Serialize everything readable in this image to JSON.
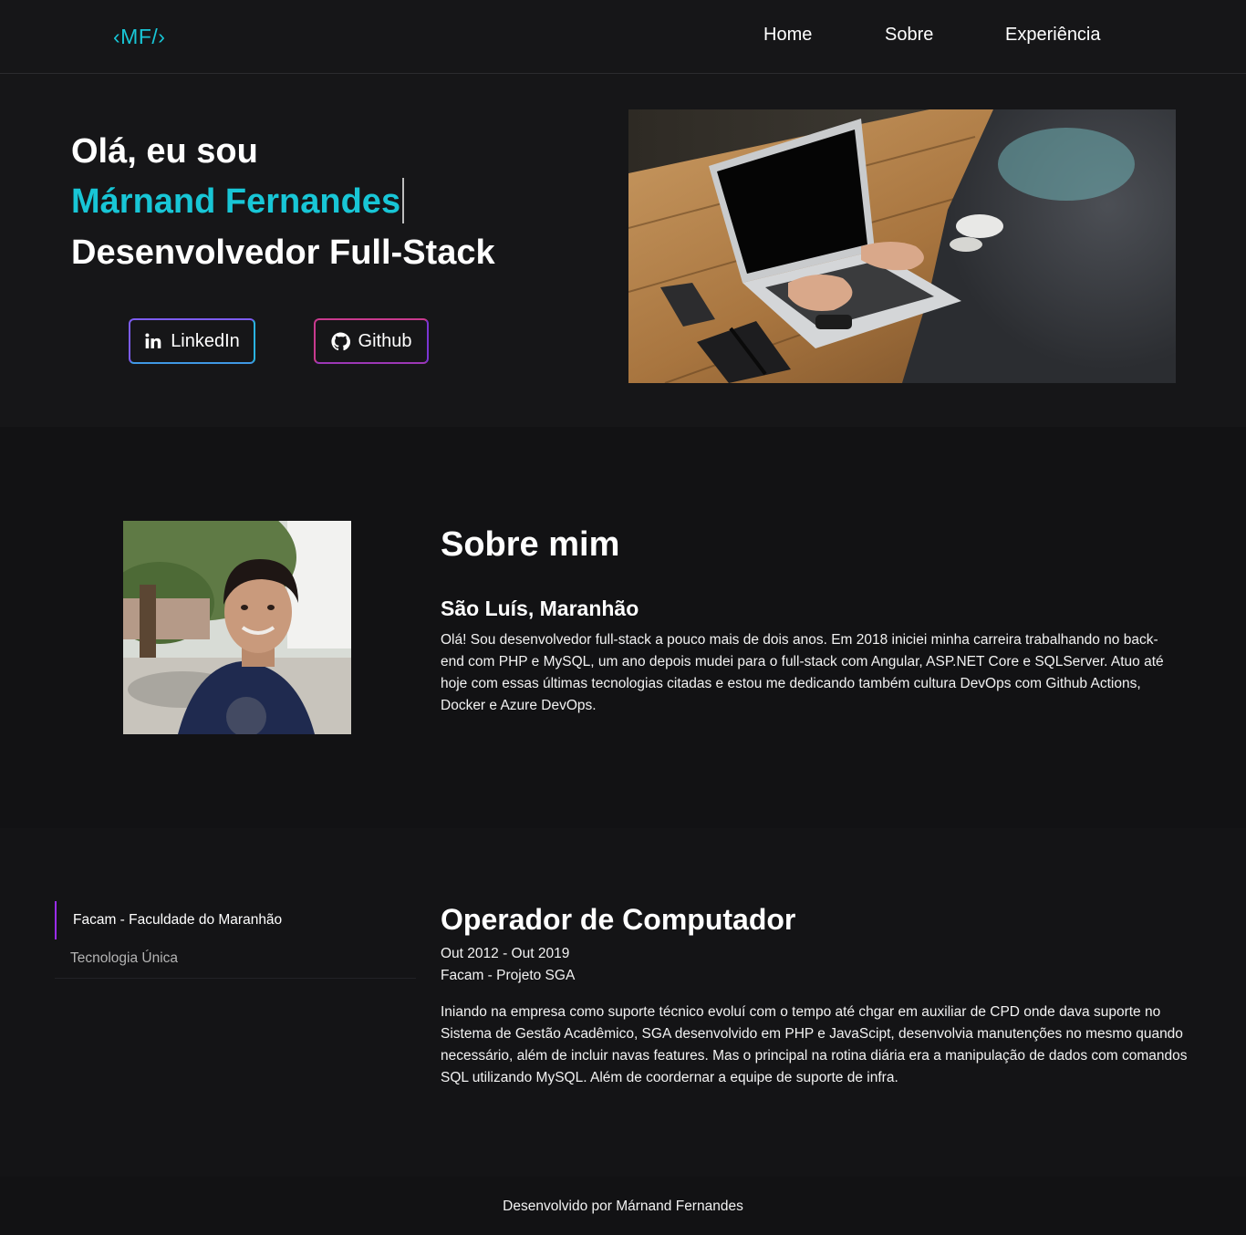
{
  "header": {
    "logo": "‹MF/›",
    "nav": [
      "Home",
      "Sobre",
      "Experiência"
    ]
  },
  "hero": {
    "greeting": "Olá, eu sou",
    "name": "Márnand Fernandes",
    "role": "Desenvolvedor Full-Stack",
    "linkedin_label": "LinkedIn",
    "github_label": "Github"
  },
  "about": {
    "title": "Sobre mim",
    "location": "São Luís, Maranhão",
    "text": "Olá! Sou desenvolvedor full-stack a pouco mais de dois anos. Em 2018 iniciei minha carreira trabalhando no back-end com PHP e MySQL, um ano depois mudei para o full-stack com Angular, ASP.NET Core e SQLServer. Atuo até hoje com essas últimas tecnologias citadas e estou me dedicando também cultura DevOps com Github Actions, Docker e Azure DevOps."
  },
  "experience": {
    "tabs": [
      "Facam - Faculdade do Maranhão",
      "Tecnologia Única"
    ],
    "active_tab": 0,
    "title": "Operador de Computador",
    "period": "Out 2012 - Out 2019",
    "company": "Facam - Projeto SGA",
    "description": "Iniando na empresa como suporte técnico evoluí com o tempo até chgar em auxiliar de CPD onde dava suporte no Sistema de Gestão Acadêmico, SGA desenvolvido em PHP e JavaScipt, desenvolvia manutenções no mesmo quando necessário, além de incluir navas features. Mas o principal na rotina diária era a manipulação de dados com comandos SQL utilizando MySQL. Além de coordernar a equipe de suporte de infra."
  },
  "footer": {
    "text": "Desenvolvido por Márnand Fernandes"
  },
  "colors": {
    "accent": "#18c6d6",
    "background": "#141416",
    "tab_indicator": "#9a2cf0"
  }
}
